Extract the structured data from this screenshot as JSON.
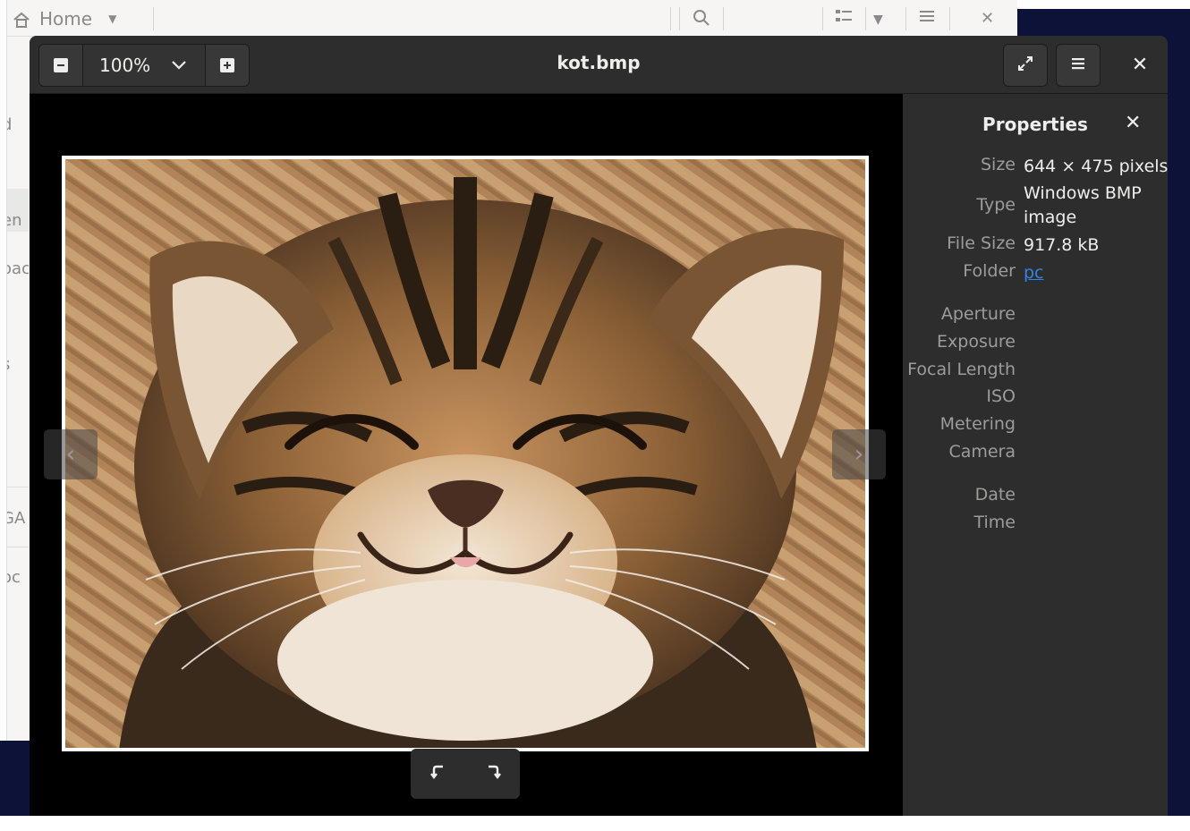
{
  "file_manager": {
    "breadcrumb": "Home",
    "sidebar_fragments": [
      "d",
      "en",
      "oac",
      "s",
      "GA",
      "oc"
    ]
  },
  "viewer": {
    "title": "kot.bmp",
    "zoom": "100%",
    "image_alt": "Smiling tabby kitten with eyes closed"
  },
  "properties": {
    "title": "Properties",
    "rows": [
      {
        "label": "Size",
        "value": "644 × 475 pixels"
      },
      {
        "label": "Type",
        "value": "Windows BMP image"
      },
      {
        "label": "File Size",
        "value": "917.8 kB"
      },
      {
        "label": "Folder",
        "value": "pc"
      },
      {
        "label": "Aperture",
        "value": ""
      },
      {
        "label": "Exposure",
        "value": ""
      },
      {
        "label": "Focal Length",
        "value": ""
      },
      {
        "label": "ISO",
        "value": ""
      },
      {
        "label": "Metering",
        "value": ""
      },
      {
        "label": "Camera",
        "value": ""
      },
      {
        "label": "Date",
        "value": ""
      },
      {
        "label": "Time",
        "value": ""
      }
    ]
  },
  "colors": {
    "headerbar": "#2d2d2d",
    "panel": "#2d2d2d",
    "canvas": "#000000",
    "text": "#eeeeec",
    "dim_text": "#9c9c9a",
    "link": "#3584e4",
    "desktop": "#0c1238"
  }
}
